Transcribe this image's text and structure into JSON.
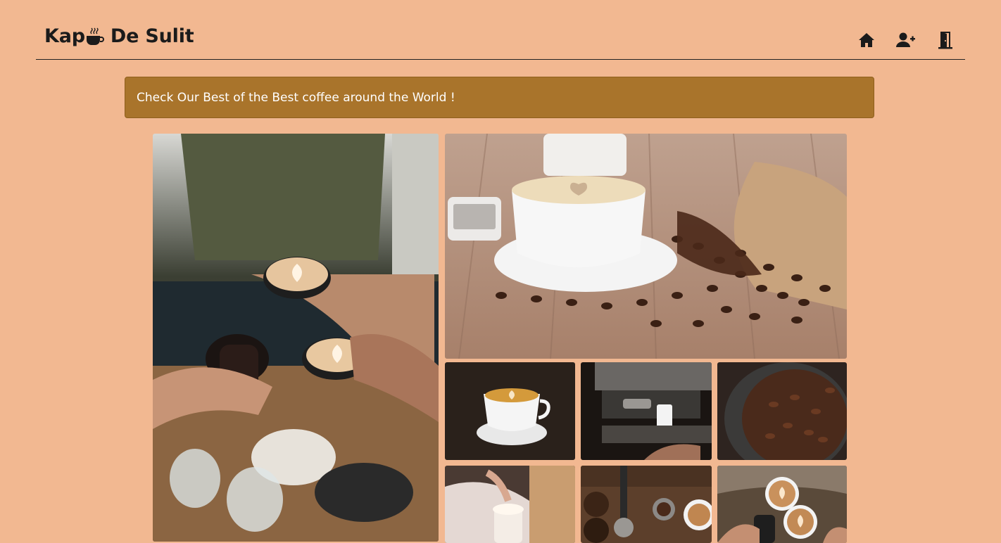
{
  "navbar": {
    "brand_prefix": "Kap",
    "brand_suffix": "De Sulit",
    "brand_icon": "coffee-cup-icon",
    "icons": [
      "home-icon",
      "user-plus-icon",
      "door-exit-icon"
    ]
  },
  "banner": {
    "text": "Check Our Best of the Best coffee around the World !"
  },
  "gallery": {
    "photos": [
      "people-toasting-coffee-photo",
      "coffee-cup-with-beans-photo",
      "latte-art-cup-photo",
      "espresso-machine-photo",
      "coffee-beans-bowl-photo",
      "woman-with-cappuccino-photo",
      "coffee-tools-flatlay-photo",
      "hands-holding-lattes-photo"
    ]
  },
  "colors": {
    "background": "#F2B891",
    "banner": "#A9742B",
    "text_dark": "#1b1b1b",
    "banner_text": "#ffffff"
  }
}
